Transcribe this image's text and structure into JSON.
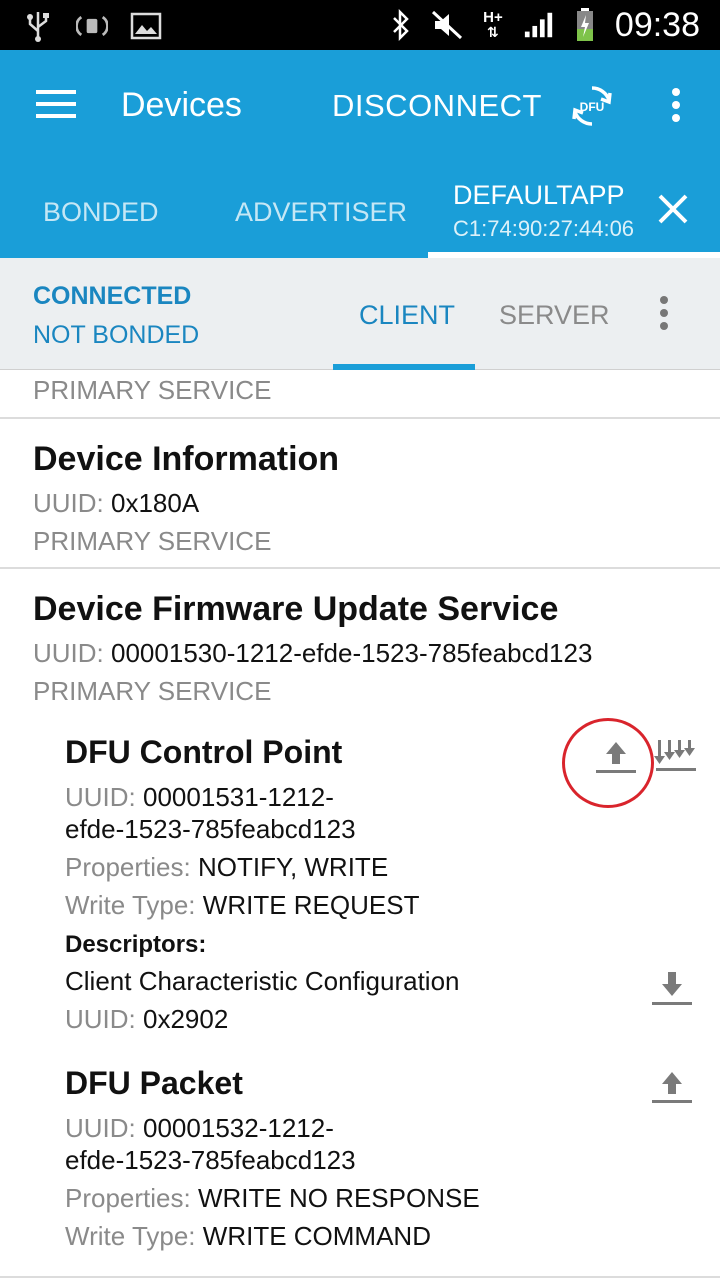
{
  "status_bar": {
    "time": "09:38",
    "network": "H+",
    "left_icons": [
      "usb-icon",
      "nfc-icon",
      "image-icon"
    ],
    "right_icons": [
      "bluetooth-icon",
      "mute-icon",
      "signal-icon",
      "battery-icon"
    ]
  },
  "app_bar": {
    "title": "Devices",
    "disconnect_label": "DISCONNECT",
    "dfu_label": "DFU",
    "background_color": "#1a9ed8"
  },
  "tabs": {
    "bonded": "BONDED",
    "advertiser": "ADVERTISER",
    "default_name": "DEFAULTAPP",
    "default_address": "C1:74:90:27:44:06"
  },
  "sub_bar": {
    "status_connected": "CONNECTED",
    "status_bonded": "NOT BONDED",
    "tab_client": "CLIENT",
    "tab_server": "SERVER",
    "accent_color": "#1a86c0"
  },
  "services": [
    {
      "type": "PRIMARY SERVICE"
    },
    {
      "name": "Device Information",
      "uuid_label": "UUID:",
      "uuid": "0x180A",
      "type": "PRIMARY SERVICE"
    },
    {
      "name": "Device Firmware Update Service",
      "uuid_label": "UUID:",
      "uuid": "00001530-1212-efde-1523-785feabcd123",
      "type": "PRIMARY SERVICE",
      "characteristics": [
        {
          "name": "DFU Control Point",
          "uuid_label": "UUID:",
          "uuid_line1": "00001531-1212-",
          "uuid_line2": "efde-1523-785feabcd123",
          "properties_label": "Properties:",
          "properties": "NOTIFY, WRITE",
          "write_type_label": "Write Type:",
          "write_type": "WRITE REQUEST",
          "descriptors_label": "Descriptors:",
          "descriptors": [
            {
              "name": "Client Characteristic Configuration",
              "uuid_label": "UUID:",
              "uuid": "0x2902"
            }
          ]
        },
        {
          "name": "DFU Packet",
          "uuid_label": "UUID:",
          "uuid_line1": "00001532-1212-",
          "uuid_line2": "efde-1523-785feabcd123",
          "properties_label": "Properties:",
          "properties": "WRITE NO RESPONSE",
          "write_type_label": "Write Type:",
          "write_type": "WRITE COMMAND"
        }
      ]
    }
  ]
}
